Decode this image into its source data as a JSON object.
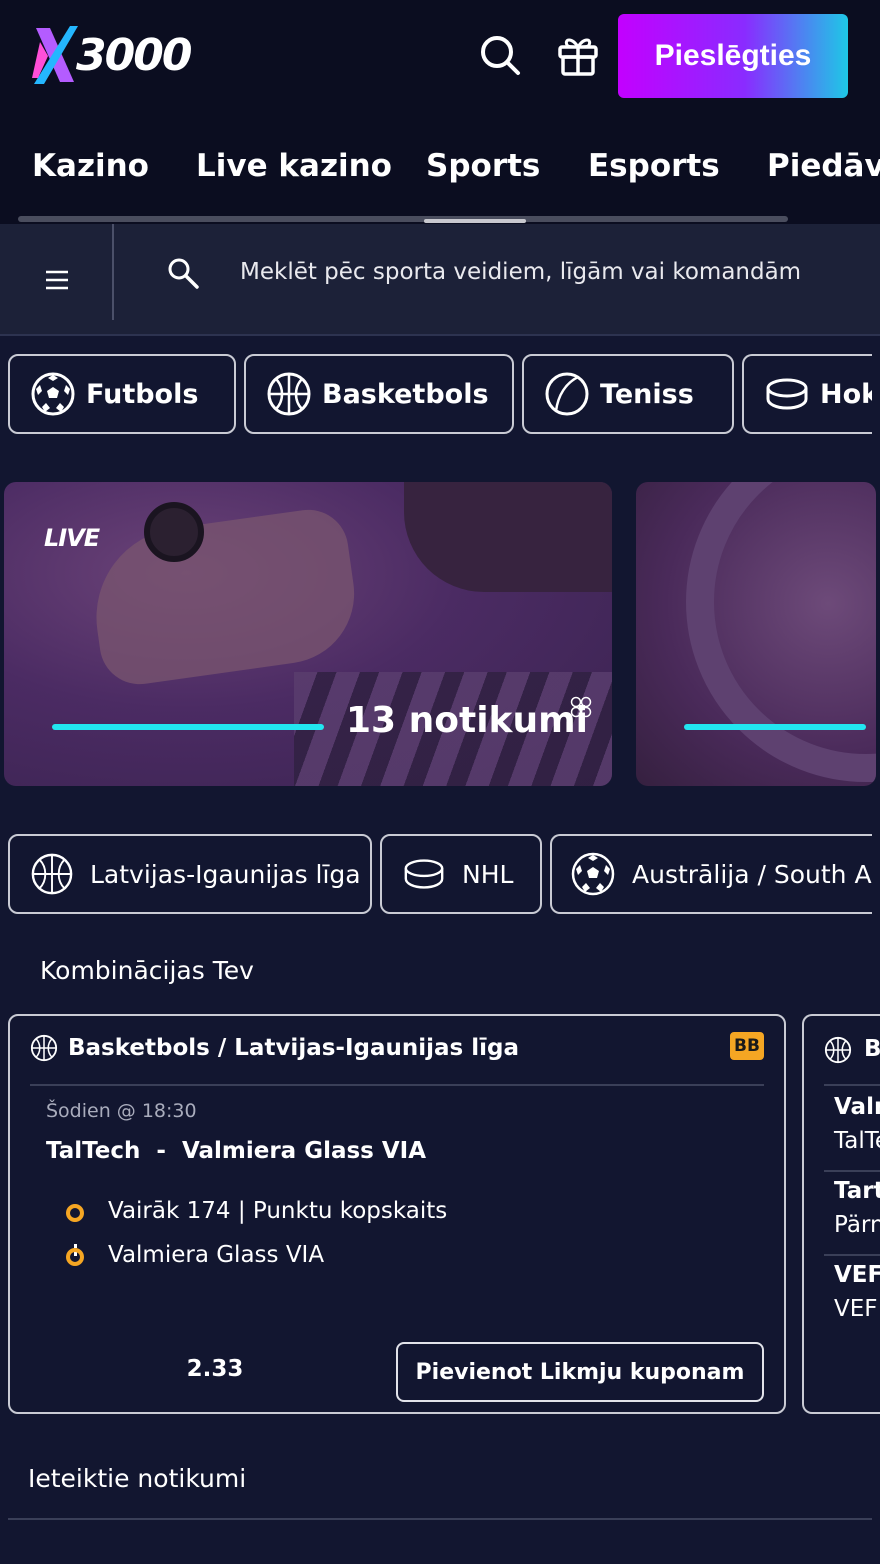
{
  "header": {
    "logo_text": "3000",
    "login_label": "Pieslēgties"
  },
  "nav": {
    "items": [
      "Kazino",
      "Live kazino",
      "Sports",
      "Esports",
      "Piedāvājumi"
    ]
  },
  "search": {
    "placeholder": "Meklēt pēc sporta veidiem, līgām vai komandām"
  },
  "sport_chips": [
    {
      "label": "Futbols",
      "icon": "soccer-ball-icon"
    },
    {
      "label": "Basketbols",
      "icon": "basketball-icon"
    },
    {
      "label": "Teniss",
      "icon": "tennis-ball-icon"
    },
    {
      "label": "Hokejs",
      "icon": "hockey-puck-icon"
    }
  ],
  "banners": [
    {
      "live_label": "LIVE",
      "count": "13 notikumi"
    },
    {
      "live_label": "",
      "count": ""
    }
  ],
  "league_chips": [
    {
      "label": "Latvijas-Igaunijas līga",
      "icon": "basketball-icon"
    },
    {
      "label": "NHL",
      "icon": "hockey-puck-icon"
    },
    {
      "label": "Austrālija / South Australia",
      "icon": "soccer-ball-icon"
    }
  ],
  "combos": {
    "title": "Kombinācijas Tev",
    "cards": [
      {
        "header": "Basketbols / Latvijas-Igaunijas līga",
        "badge": "BB",
        "time": "Šodien @ 18:30",
        "match": "TalTech  -  Valmiera Glass VIA",
        "selections": [
          "Vairāk 174 | Punktu kopskaits",
          "Valmiera Glass VIA"
        ],
        "odds": "2.33",
        "add_label": "Pievienot Likmju kuponam"
      },
      {
        "header": "Basketbols",
        "rows": [
          {
            "title": "Valmiera",
            "sub": "TalTech"
          },
          {
            "title": "Tartu",
            "sub": "Pärnu"
          },
          {
            "title": "VEF",
            "sub": "VEF Rīga"
          }
        ]
      }
    ]
  },
  "featured": {
    "title": "Ieteiktie notikumi"
  },
  "colors": {
    "background": "#121630",
    "topbar": "#0b0d20",
    "accent_cyan": "#22e6f0",
    "accent_orange": "#f5a623",
    "login_gradient_start": "#c300ff",
    "login_gradient_end": "#1ec8e6"
  }
}
